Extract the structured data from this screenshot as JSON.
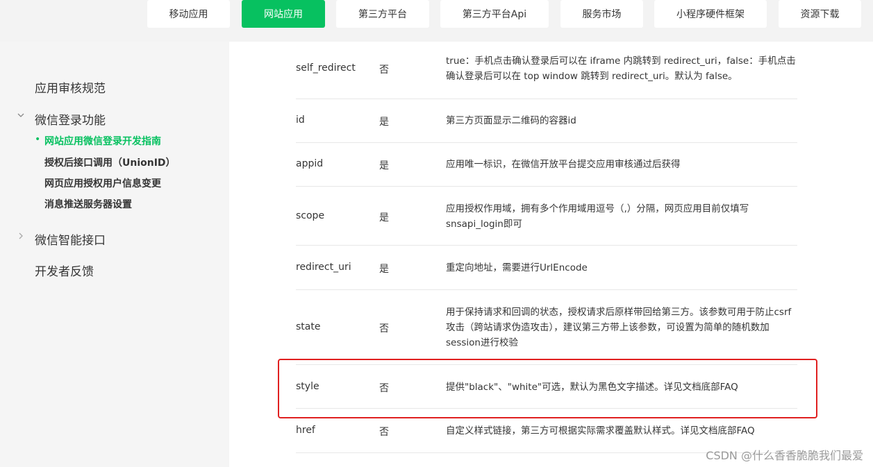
{
  "top_nav": {
    "tabs": [
      {
        "label": "移动应用",
        "active": false
      },
      {
        "label": "网站应用",
        "active": true
      },
      {
        "label": "第三方平台",
        "active": false
      },
      {
        "label": "第三方平台Api",
        "active": false
      },
      {
        "label": "服务市场",
        "active": false
      },
      {
        "label": "小程序硬件框架",
        "active": false
      },
      {
        "label": "资源下载",
        "active": false
      }
    ]
  },
  "sidebar": {
    "group_review": "应用审核规范",
    "group_login": "微信登录功能",
    "sub_items": [
      {
        "label": "网站应用微信登录开发指南",
        "active": true
      },
      {
        "label": "授权后接口调用（UnionID）",
        "active": false
      },
      {
        "label": "网页应用授权用户信息变更",
        "active": false
      },
      {
        "label": "消息推送服务器设置",
        "active": false
      }
    ],
    "group_smart": "微信智能接口",
    "group_feedback": "开发者反馈"
  },
  "params_table": {
    "rows": [
      {
        "name": "self_redirect",
        "required": "否",
        "desc": "true：手机点击确认登录后可以在 iframe 内跳转到 redirect_uri，false：手机点击确认登录后可以在 top window 跳转到 redirect_uri。默认为 false。"
      },
      {
        "name": "id",
        "required": "是",
        "desc": "第三方页面显示二维码的容器id"
      },
      {
        "name": "appid",
        "required": "是",
        "desc": "应用唯一标识，在微信开放平台提交应用审核通过后获得"
      },
      {
        "name": "scope",
        "required": "是",
        "desc": "应用授权作用域，拥有多个作用域用逗号（,）分隔，网页应用目前仅填写snsapi_login即可"
      },
      {
        "name": "redirect_uri",
        "required": "是",
        "desc": "重定向地址，需要进行UrlEncode"
      },
      {
        "name": "state",
        "required": "否",
        "desc": "用于保持请求和回调的状态，授权请求后原样带回给第三方。该参数可用于防止csrf攻击（跨站请求伪造攻击），建议第三方带上该参数，可设置为简单的随机数加session进行校验"
      },
      {
        "name": "style",
        "required": "否",
        "desc": "提供\"black\"、\"white\"可选，默认为黑色文字描述。详见文档底部FAQ"
      },
      {
        "name": "href",
        "required": "否",
        "desc": "自定义样式链接，第三方可根据实际需求覆盖默认样式。详见文档底部FAQ"
      }
    ]
  },
  "watermark": "CSDN @什么香香脆脆我们最爱",
  "colors": {
    "accent": "#07c160",
    "highlight_border": "#e02020"
  },
  "icons": {
    "group_login_chevron": "chevron-down-icon",
    "group_smart_chevron": "chevron-right-icon"
  }
}
